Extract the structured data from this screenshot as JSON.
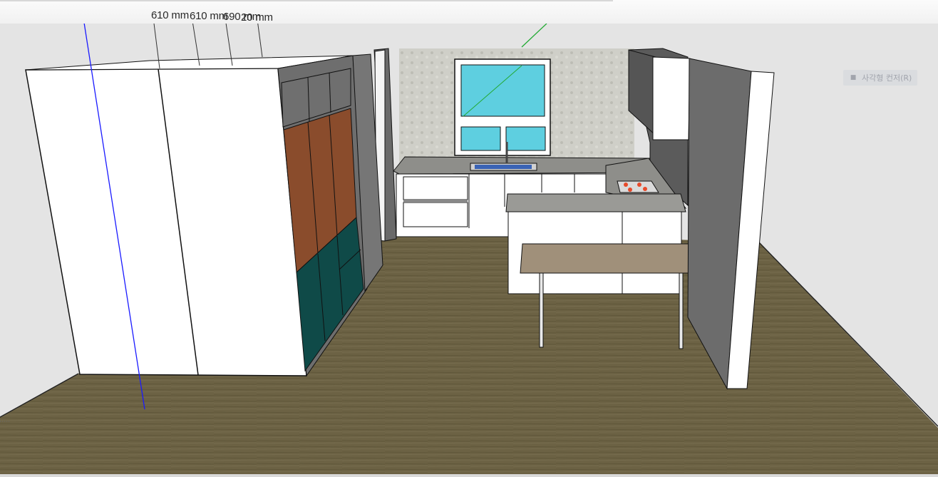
{
  "dimensions": {
    "label_1": "610 mm",
    "label_2": "610 mm",
    "label_3": "690 mm",
    "label_4": "20 mm"
  },
  "hint": {
    "text": "사각형 컨저(R)",
    "icon": "rectangle-tool-icon"
  },
  "colors": {
    "sky": "#5ecfe0",
    "floor": "#6c6244",
    "upper_cabinet": "#8a4c2c",
    "lower_cabinet": "#0f4a48",
    "wall": "#6c6c6c",
    "axis_blue": "#1a1aff",
    "axis_green": "#22aa33"
  }
}
